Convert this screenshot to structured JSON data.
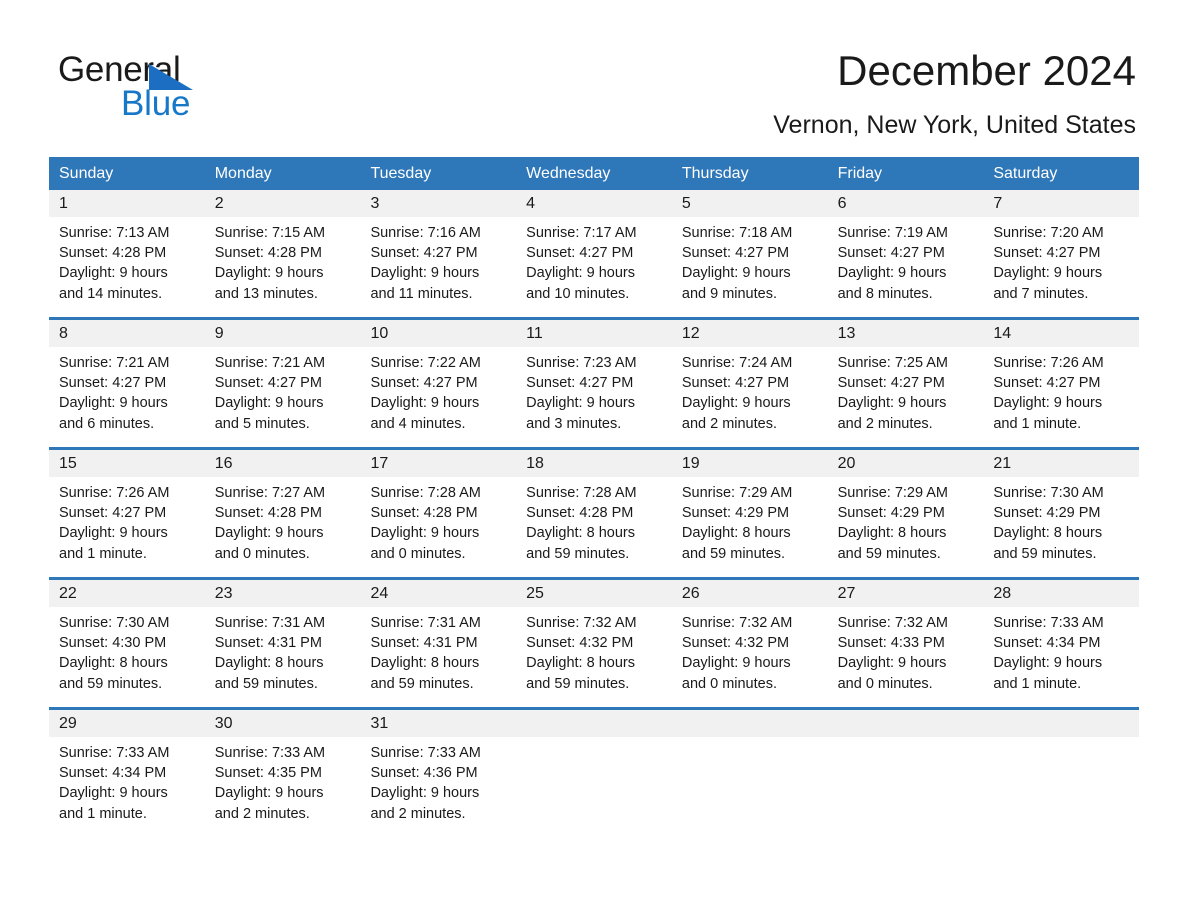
{
  "brand": {
    "name_top": "General",
    "name_bottom": "Blue",
    "triangle_color": "#1b6ec2",
    "blue_text_color": "#1878c8"
  },
  "header": {
    "title": "December 2024",
    "subtitle": "Vernon, New York, United States"
  },
  "theme": {
    "header_blue": "#2e77b8",
    "daynum_band": "#f1f1f1",
    "text": "#1a1a1a",
    "page_background": "#ffffff"
  },
  "weekdays": [
    "Sunday",
    "Monday",
    "Tuesday",
    "Wednesday",
    "Thursday",
    "Friday",
    "Saturday"
  ],
  "labels": {
    "sunrise_prefix": "Sunrise:",
    "sunset_prefix": "Sunset:",
    "daylight_prefix": "Daylight:"
  },
  "weeks": [
    {
      "days": [
        {
          "date": "1",
          "sunrise": "Sunrise: 7:13 AM",
          "sunset": "Sunset: 4:28 PM",
          "daylight_line1": "Daylight: 9 hours",
          "daylight_line2": "and 14 minutes."
        },
        {
          "date": "2",
          "sunrise": "Sunrise: 7:15 AM",
          "sunset": "Sunset: 4:28 PM",
          "daylight_line1": "Daylight: 9 hours",
          "daylight_line2": "and 13 minutes."
        },
        {
          "date": "3",
          "sunrise": "Sunrise: 7:16 AM",
          "sunset": "Sunset: 4:27 PM",
          "daylight_line1": "Daylight: 9 hours",
          "daylight_line2": "and 11 minutes."
        },
        {
          "date": "4",
          "sunrise": "Sunrise: 7:17 AM",
          "sunset": "Sunset: 4:27 PM",
          "daylight_line1": "Daylight: 9 hours",
          "daylight_line2": "and 10 minutes."
        },
        {
          "date": "5",
          "sunrise": "Sunrise: 7:18 AM",
          "sunset": "Sunset: 4:27 PM",
          "daylight_line1": "Daylight: 9 hours",
          "daylight_line2": "and 9 minutes."
        },
        {
          "date": "6",
          "sunrise": "Sunrise: 7:19 AM",
          "sunset": "Sunset: 4:27 PM",
          "daylight_line1": "Daylight: 9 hours",
          "daylight_line2": "and 8 minutes."
        },
        {
          "date": "7",
          "sunrise": "Sunrise: 7:20 AM",
          "sunset": "Sunset: 4:27 PM",
          "daylight_line1": "Daylight: 9 hours",
          "daylight_line2": "and 7 minutes."
        }
      ]
    },
    {
      "days": [
        {
          "date": "8",
          "sunrise": "Sunrise: 7:21 AM",
          "sunset": "Sunset: 4:27 PM",
          "daylight_line1": "Daylight: 9 hours",
          "daylight_line2": "and 6 minutes."
        },
        {
          "date": "9",
          "sunrise": "Sunrise: 7:21 AM",
          "sunset": "Sunset: 4:27 PM",
          "daylight_line1": "Daylight: 9 hours",
          "daylight_line2": "and 5 minutes."
        },
        {
          "date": "10",
          "sunrise": "Sunrise: 7:22 AM",
          "sunset": "Sunset: 4:27 PM",
          "daylight_line1": "Daylight: 9 hours",
          "daylight_line2": "and 4 minutes."
        },
        {
          "date": "11",
          "sunrise": "Sunrise: 7:23 AM",
          "sunset": "Sunset: 4:27 PM",
          "daylight_line1": "Daylight: 9 hours",
          "daylight_line2": "and 3 minutes."
        },
        {
          "date": "12",
          "sunrise": "Sunrise: 7:24 AM",
          "sunset": "Sunset: 4:27 PM",
          "daylight_line1": "Daylight: 9 hours",
          "daylight_line2": "and 2 minutes."
        },
        {
          "date": "13",
          "sunrise": "Sunrise: 7:25 AM",
          "sunset": "Sunset: 4:27 PM",
          "daylight_line1": "Daylight: 9 hours",
          "daylight_line2": "and 2 minutes."
        },
        {
          "date": "14",
          "sunrise": "Sunrise: 7:26 AM",
          "sunset": "Sunset: 4:27 PM",
          "daylight_line1": "Daylight: 9 hours",
          "daylight_line2": "and 1 minute."
        }
      ]
    },
    {
      "days": [
        {
          "date": "15",
          "sunrise": "Sunrise: 7:26 AM",
          "sunset": "Sunset: 4:27 PM",
          "daylight_line1": "Daylight: 9 hours",
          "daylight_line2": "and 1 minute."
        },
        {
          "date": "16",
          "sunrise": "Sunrise: 7:27 AM",
          "sunset": "Sunset: 4:28 PM",
          "daylight_line1": "Daylight: 9 hours",
          "daylight_line2": "and 0 minutes."
        },
        {
          "date": "17",
          "sunrise": "Sunrise: 7:28 AM",
          "sunset": "Sunset: 4:28 PM",
          "daylight_line1": "Daylight: 9 hours",
          "daylight_line2": "and 0 minutes."
        },
        {
          "date": "18",
          "sunrise": "Sunrise: 7:28 AM",
          "sunset": "Sunset: 4:28 PM",
          "daylight_line1": "Daylight: 8 hours",
          "daylight_line2": "and 59 minutes."
        },
        {
          "date": "19",
          "sunrise": "Sunrise: 7:29 AM",
          "sunset": "Sunset: 4:29 PM",
          "daylight_line1": "Daylight: 8 hours",
          "daylight_line2": "and 59 minutes."
        },
        {
          "date": "20",
          "sunrise": "Sunrise: 7:29 AM",
          "sunset": "Sunset: 4:29 PM",
          "daylight_line1": "Daylight: 8 hours",
          "daylight_line2": "and 59 minutes."
        },
        {
          "date": "21",
          "sunrise": "Sunrise: 7:30 AM",
          "sunset": "Sunset: 4:29 PM",
          "daylight_line1": "Daylight: 8 hours",
          "daylight_line2": "and 59 minutes."
        }
      ]
    },
    {
      "days": [
        {
          "date": "22",
          "sunrise": "Sunrise: 7:30 AM",
          "sunset": "Sunset: 4:30 PM",
          "daylight_line1": "Daylight: 8 hours",
          "daylight_line2": "and 59 minutes."
        },
        {
          "date": "23",
          "sunrise": "Sunrise: 7:31 AM",
          "sunset": "Sunset: 4:31 PM",
          "daylight_line1": "Daylight: 8 hours",
          "daylight_line2": "and 59 minutes."
        },
        {
          "date": "24",
          "sunrise": "Sunrise: 7:31 AM",
          "sunset": "Sunset: 4:31 PM",
          "daylight_line1": "Daylight: 8 hours",
          "daylight_line2": "and 59 minutes."
        },
        {
          "date": "25",
          "sunrise": "Sunrise: 7:32 AM",
          "sunset": "Sunset: 4:32 PM",
          "daylight_line1": "Daylight: 8 hours",
          "daylight_line2": "and 59 minutes."
        },
        {
          "date": "26",
          "sunrise": "Sunrise: 7:32 AM",
          "sunset": "Sunset: 4:32 PM",
          "daylight_line1": "Daylight: 9 hours",
          "daylight_line2": "and 0 minutes."
        },
        {
          "date": "27",
          "sunrise": "Sunrise: 7:32 AM",
          "sunset": "Sunset: 4:33 PM",
          "daylight_line1": "Daylight: 9 hours",
          "daylight_line2": "and 0 minutes."
        },
        {
          "date": "28",
          "sunrise": "Sunrise: 7:33 AM",
          "sunset": "Sunset: 4:34 PM",
          "daylight_line1": "Daylight: 9 hours",
          "daylight_line2": "and 1 minute."
        }
      ]
    },
    {
      "days": [
        {
          "date": "29",
          "sunrise": "Sunrise: 7:33 AM",
          "sunset": "Sunset: 4:34 PM",
          "daylight_line1": "Daylight: 9 hours",
          "daylight_line2": "and 1 minute."
        },
        {
          "date": "30",
          "sunrise": "Sunrise: 7:33 AM",
          "sunset": "Sunset: 4:35 PM",
          "daylight_line1": "Daylight: 9 hours",
          "daylight_line2": "and 2 minutes."
        },
        {
          "date": "31",
          "sunrise": "Sunrise: 7:33 AM",
          "sunset": "Sunset: 4:36 PM",
          "daylight_line1": "Daylight: 9 hours",
          "daylight_line2": "and 2 minutes."
        },
        {
          "date": "",
          "sunrise": "",
          "sunset": "",
          "daylight_line1": "",
          "daylight_line2": ""
        },
        {
          "date": "",
          "sunrise": "",
          "sunset": "",
          "daylight_line1": "",
          "daylight_line2": ""
        },
        {
          "date": "",
          "sunrise": "",
          "sunset": "",
          "daylight_line1": "",
          "daylight_line2": ""
        },
        {
          "date": "",
          "sunrise": "",
          "sunset": "",
          "daylight_line1": "",
          "daylight_line2": ""
        }
      ]
    }
  ]
}
